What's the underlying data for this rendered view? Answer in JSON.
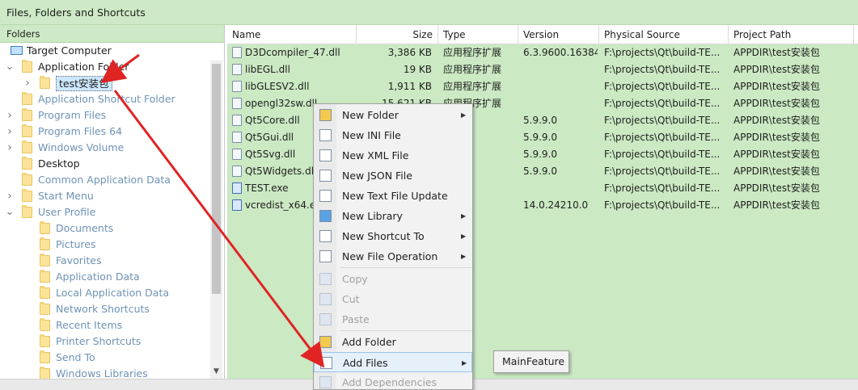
{
  "window": {
    "title": "Files, Folders and Shortcuts"
  },
  "folders": {
    "header": "Folders",
    "tree": [
      {
        "label": "Target Computer",
        "style": "dark",
        "icon": "computer-icon",
        "level": 0
      },
      {
        "label": "Application Folder",
        "style": "dark",
        "icon": "folder-icon",
        "level": 0,
        "expanded": true
      },
      {
        "label": "test安装包",
        "style": "dark",
        "icon": "folder-icon",
        "level": 1,
        "selected": true,
        "collapsed": true
      },
      {
        "label": "Application Shortcut Folder",
        "style": "gray",
        "icon": "folder-icon",
        "level": 0
      },
      {
        "label": "Program Files",
        "style": "gray",
        "icon": "folder-icon",
        "level": 0,
        "collapsed": true
      },
      {
        "label": "Program Files 64",
        "style": "gray",
        "icon": "folder-icon",
        "level": 0,
        "collapsed": true
      },
      {
        "label": "Windows Volume",
        "style": "gray",
        "icon": "folder-icon",
        "level": 0,
        "collapsed": true
      },
      {
        "label": "Desktop",
        "style": "dark",
        "icon": "folder-icon",
        "level": 0
      },
      {
        "label": "Common Application Data",
        "style": "gray",
        "icon": "folder-icon",
        "level": 0
      },
      {
        "label": "Start Menu",
        "style": "gray",
        "icon": "folder-icon",
        "level": 0,
        "collapsed": true
      },
      {
        "label": "User Profile",
        "style": "gray",
        "icon": "folder-icon",
        "level": 0,
        "expanded": true
      },
      {
        "label": "Documents",
        "style": "gray",
        "icon": "folder-icon",
        "level": 1
      },
      {
        "label": "Pictures",
        "style": "gray",
        "icon": "folder-icon",
        "level": 1
      },
      {
        "label": "Favorites",
        "style": "gray",
        "icon": "folder-icon",
        "level": 1
      },
      {
        "label": "Application Data",
        "style": "gray",
        "icon": "folder-icon",
        "level": 1
      },
      {
        "label": "Local Application Data",
        "style": "gray",
        "icon": "folder-icon",
        "level": 1
      },
      {
        "label": "Network Shortcuts",
        "style": "gray",
        "icon": "folder-icon",
        "level": 1
      },
      {
        "label": "Recent Items",
        "style": "gray",
        "icon": "folder-icon",
        "level": 1
      },
      {
        "label": "Printer Shortcuts",
        "style": "gray",
        "icon": "folder-icon",
        "level": 1
      },
      {
        "label": "Send To",
        "style": "gray",
        "icon": "folder-icon",
        "level": 1
      },
      {
        "label": "Windows Libraries",
        "style": "gray",
        "icon": "folder-icon",
        "level": 1
      }
    ]
  },
  "files": {
    "columns": [
      "Name",
      "Size",
      "Type",
      "Version",
      "Physical Source",
      "Project Path"
    ],
    "rows": [
      {
        "name": "D3Dcompiler_47.dll",
        "size": "3,386 KB",
        "type": "应用程序扩展",
        "version": "6.3.9600.16384",
        "source": "F:\\projects\\Qt\\build-TE...",
        "path": "APPDIR\\test安装包"
      },
      {
        "name": "libEGL.dll",
        "size": "19 KB",
        "type": "应用程序扩展",
        "version": "",
        "source": "F:\\projects\\Qt\\build-TE...",
        "path": "APPDIR\\test安装包"
      },
      {
        "name": "libGLESV2.dll",
        "size": "1,911 KB",
        "type": "应用程序扩展",
        "version": "",
        "source": "F:\\projects\\Qt\\build-TE...",
        "path": "APPDIR\\test安装包"
      },
      {
        "name": "opengl32sw.dll",
        "size": "15,621 KB",
        "type": "应用程序扩展",
        "version": "",
        "source": "F:\\projects\\Qt\\build-TE...",
        "path": "APPDIR\\test安装包"
      },
      {
        "name": "Qt5Core.dll",
        "size": "",
        "type": "扩展",
        "version": "5.9.9.0",
        "source": "F:\\projects\\Qt\\build-TE...",
        "path": "APPDIR\\test安装包"
      },
      {
        "name": "Qt5Gui.dll",
        "size": "",
        "type": "扩展",
        "version": "5.9.9.0",
        "source": "F:\\projects\\Qt\\build-TE...",
        "path": "APPDIR\\test安装包"
      },
      {
        "name": "Qt5Svg.dll",
        "size": "",
        "type": "扩展",
        "version": "5.9.9.0",
        "source": "F:\\projects\\Qt\\build-TE...",
        "path": "APPDIR\\test安装包"
      },
      {
        "name": "Qt5Widgets.dll",
        "size": "",
        "type": "扩展",
        "version": "5.9.9.0",
        "source": "F:\\projects\\Qt\\build-TE...",
        "path": "APPDIR\\test安装包"
      },
      {
        "name": "TEST.exe",
        "size": "",
        "type": "序",
        "version": "",
        "source": "F:\\projects\\Qt\\build-TE...",
        "path": "APPDIR\\test安装包"
      },
      {
        "name": "vcredist_x64.exe",
        "size": "",
        "type": "序",
        "version": "14.0.24210.0",
        "source": "F:\\projects\\Qt\\build-TE...",
        "path": "APPDIR\\test安装包"
      }
    ]
  },
  "context_menu": {
    "items": [
      {
        "label": "New Folder",
        "icon": "new-folder-icon",
        "submenu": true,
        "disabled": false
      },
      {
        "label": "New INI File",
        "icon": "ini-file-icon",
        "submenu": false,
        "disabled": false
      },
      {
        "label": "New XML File",
        "icon": "xml-file-icon",
        "submenu": false,
        "disabled": false
      },
      {
        "label": "New JSON File",
        "icon": "json-file-icon",
        "submenu": false,
        "disabled": false
      },
      {
        "label": "New Text File Update",
        "icon": "text-file-icon",
        "submenu": false,
        "disabled": false
      },
      {
        "label": "New Library",
        "icon": "library-icon",
        "submenu": true,
        "disabled": false
      },
      {
        "label": "New Shortcut To",
        "icon": "shortcut-icon",
        "submenu": true,
        "disabled": false
      },
      {
        "label": "New File Operation",
        "icon": "file-operation-icon",
        "submenu": true,
        "disabled": false
      },
      {
        "sep": true
      },
      {
        "label": "Copy",
        "icon": "copy-icon",
        "submenu": false,
        "disabled": true
      },
      {
        "label": "Cut",
        "icon": "cut-icon",
        "submenu": false,
        "disabled": true
      },
      {
        "label": "Paste",
        "icon": "paste-icon",
        "submenu": false,
        "disabled": true
      },
      {
        "sep": true
      },
      {
        "label": "Add Folder",
        "icon": "add-folder-icon",
        "submenu": false,
        "disabled": false
      },
      {
        "label": "Add Files",
        "icon": "add-files-icon",
        "submenu": true,
        "disabled": false,
        "highlighted": true
      },
      {
        "label": "Add Dependencies",
        "icon": "dependencies-icon",
        "submenu": false,
        "disabled": true
      }
    ],
    "submenu": {
      "label": "MainFeature"
    }
  },
  "colors": {
    "green_bg": "#cbe9c3",
    "header_green": "#cde9c5",
    "arrow": "#e02424",
    "tree_gray": "#6e93b6"
  }
}
